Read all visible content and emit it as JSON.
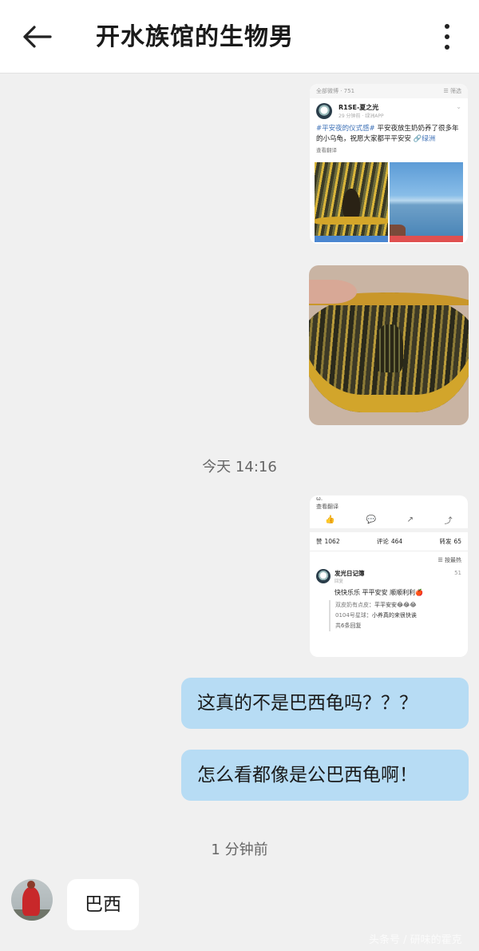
{
  "header": {
    "title": "开水族馆的生物男",
    "back_icon": "arrow-left-icon",
    "more_icon": "more-vertical-icon"
  },
  "shared_post": {
    "topbar_left": "全部微博 · 751",
    "topbar_right": "☰ 筛选",
    "author": "R1SE-夏之光",
    "time": "29 分钟前 · 绿洲APP",
    "tag": "#平安夜的仪式感#",
    "text": "平安夜放生奶奶养了很多年的小乌龟，祝愿大家都平平安安",
    "location": "🔗绿洲",
    "translate": "查看翻译"
  },
  "timestamps": {
    "first": "今天 14:16",
    "second": "1 分钟前"
  },
  "comments_shot": {
    "top_fragment": "ω.",
    "translate": "查看翻译",
    "stats": {
      "likes_label": "赞",
      "likes": "1062",
      "comments_label": "评论",
      "comments": "464",
      "reposts_label": "转发",
      "reposts": "65"
    },
    "sort": "☰ 按最热",
    "comment": {
      "name": "发光日记簿",
      "likes": "51",
      "sub": "回复",
      "text": "快快乐乐 平平安安 顺顺利利🍎"
    },
    "replies": [
      {
        "name": "双皮奶有点皮",
        "text": "平平安安😂😂😂"
      },
      {
        "name": "0104号星球",
        "text": "小养真的来很快诶"
      }
    ],
    "more_replies": "共6条回复"
  },
  "messages": {
    "out1": "这真的不是巴西龟吗？？？",
    "out2": "怎么看都像是公巴西龟啊！",
    "in1": "巴西"
  },
  "watermark": "头条号 / 研味的霍克"
}
